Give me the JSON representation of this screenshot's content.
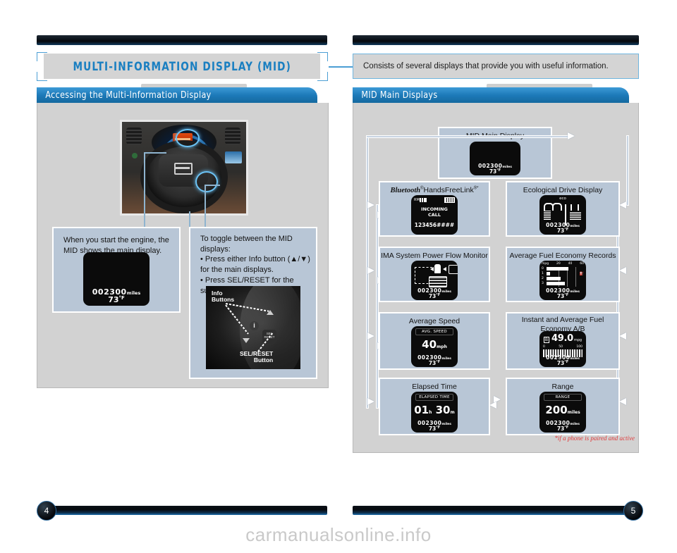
{
  "left_page": {
    "page_number": "4",
    "section_title": "MULTI-INFORMATION DISPLAY (MID)",
    "panel_heading": "Accessing the Multi-Information Display",
    "card1": {
      "text": "When you start the engine, the MID shows the main display.",
      "mid": {
        "odometer": "002300",
        "odometer_unit": "miles",
        "temperature": "73",
        "temperature_unit": "°F"
      }
    },
    "card2": {
      "text": "To toggle between the MID displays:\n• Press either Info button (▲/▼) for the main displays.\n• Press SEL/RESET for the sub-displays.",
      "photo_labels": {
        "info": "Info\nButtons",
        "sel": "SEL/RESET\nButton",
        "sel_button_face": "SEL\nRESET",
        "info_glyph": "i"
      }
    }
  },
  "right_page": {
    "page_number": "5",
    "intro": "Consists of several displays that provide you with useful information.",
    "panel_heading": "MID Main Displays",
    "footnote": "*if a phone is paired and active",
    "main_display": {
      "title": "MID Main Display",
      "mid": {
        "odometer": "002300",
        "odometer_unit": "miles",
        "temperature": "73",
        "temperature_unit": "°F"
      }
    },
    "displays": [
      {
        "title": "Bluetooth®HandsFreeLink®*",
        "title_rich": true,
        "screen": {
          "status_left": "RM",
          "signal_icon": "signal-bars-icon",
          "battery_icon": "battery-icon",
          "line1": "INCOMING",
          "line2": "CALL",
          "number": "123456####"
        }
      },
      {
        "title": "Ecological Drive Display",
        "screen": {
          "label": "eco",
          "odometer": "002300",
          "odometer_unit": "miles",
          "temperature": "73",
          "temperature_unit": "°F"
        }
      },
      {
        "title": "IMA System Power Flow Monitor",
        "screen": {
          "car_icon": "car-icon",
          "battery_icon": "ima-battery-icon",
          "engine_icon": "engine-icon",
          "odometer": "002300",
          "odometer_unit": "miles",
          "temperature": "73",
          "temperature_unit": "°F"
        }
      },
      {
        "title": "Average Fuel Economy Records",
        "screen": {
          "axis_unit": "mpg",
          "axis_ticks": [
            "20",
            "40",
            "60"
          ],
          "rows": [
            "0",
            "1",
            "2",
            "3"
          ],
          "bar_values": [
            52,
            8,
            34,
            44
          ],
          "odometer": "002300",
          "odometer_unit": "miles",
          "temperature": "73",
          "temperature_unit": "°F"
        }
      },
      {
        "title": "Average Speed",
        "screen": {
          "caption": "AVG. SPEED",
          "value": "40",
          "unit": "mph",
          "odometer": "002300",
          "odometer_unit": "miles",
          "temperature": "73",
          "temperature_unit": "°F"
        }
      },
      {
        "title": "Instant and Average Fuel Economy A/B",
        "screen": {
          "mode": "B",
          "value": "49.0",
          "unit": "mpg",
          "scale": [
            "0",
            "50",
            "100"
          ],
          "odometer": "002300",
          "odometer_unit": "miles",
          "temperature": "73",
          "temperature_unit": "°F"
        }
      },
      {
        "title": "Elapsed Time",
        "screen": {
          "caption": "ELAPSED TIME",
          "hours": "01",
          "hours_unit": "h",
          "minutes": "30",
          "minutes_unit": "m",
          "odometer": "002300",
          "odometer_unit": "miles",
          "temperature": "73",
          "temperature_unit": "°F"
        }
      },
      {
        "title": "Range",
        "screen": {
          "caption": "RANGE",
          "value": "200",
          "unit": "miles",
          "odometer": "002300",
          "odometer_unit": "miles",
          "temperature": "73",
          "temperature_unit": "°F"
        }
      }
    ]
  },
  "watermark": "carmanualsonline.info",
  "colors": {
    "accent_blue": "#1a7fc1",
    "panel_bg": "#d2d2d2",
    "card_bg": "#b8c6d6",
    "footnote_red": "#e03a3a"
  }
}
